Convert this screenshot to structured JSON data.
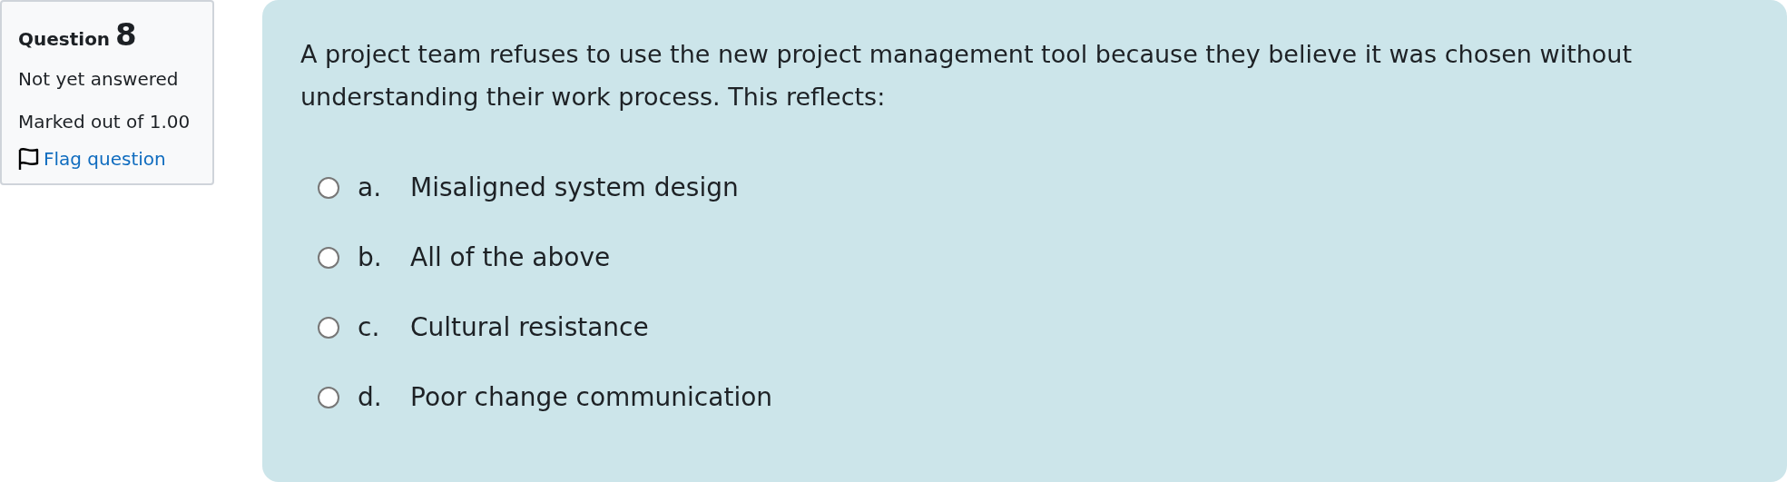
{
  "info": {
    "label": "Question",
    "number": "8",
    "state": "Not yet answered",
    "grade": "Marked out of 1.00",
    "flag": {
      "label": "Flag question",
      "flagged": false
    }
  },
  "question": {
    "text": "A project team refuses to use the new project management tool because they believe it was chosen without understanding their work process. This reflects:",
    "options": [
      {
        "letter": "a.",
        "text": "Misaligned system design",
        "selected": false
      },
      {
        "letter": "b.",
        "text": "All of the above",
        "selected": false
      },
      {
        "letter": "c.",
        "text": "Cultural resistance",
        "selected": false
      },
      {
        "letter": "d.",
        "text": "Poor change communication",
        "selected": false
      }
    ]
  }
}
